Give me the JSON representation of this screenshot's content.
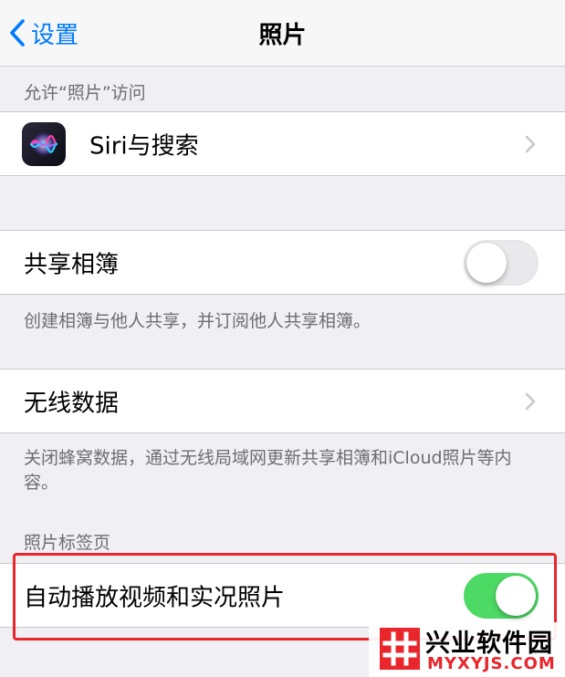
{
  "nav": {
    "back_label": "设置",
    "title": "照片"
  },
  "section_access": {
    "header": "允许“照片”访问",
    "siri_label": "Siri与搜索"
  },
  "shared_albums": {
    "label": "共享相簿",
    "toggle_on": false,
    "footer": "创建相簿与他人共享，并订阅他人共享相簿。"
  },
  "wireless_data": {
    "label": "无线数据",
    "footer": "关闭蜂窝数据，通过无线局域网更新共享相簿和iCloud照片等内容。"
  },
  "photos_tab": {
    "header": "照片标签页",
    "autoplay_label": "自动播放视频和实况照片",
    "toggle_on": true
  },
  "watermark": {
    "name": "兴业软件园",
    "domain": "MYXYJS.COM"
  },
  "colors": {
    "accent": "#007aff",
    "toggle_on": "#4cd964",
    "highlight": "#e8262b"
  }
}
